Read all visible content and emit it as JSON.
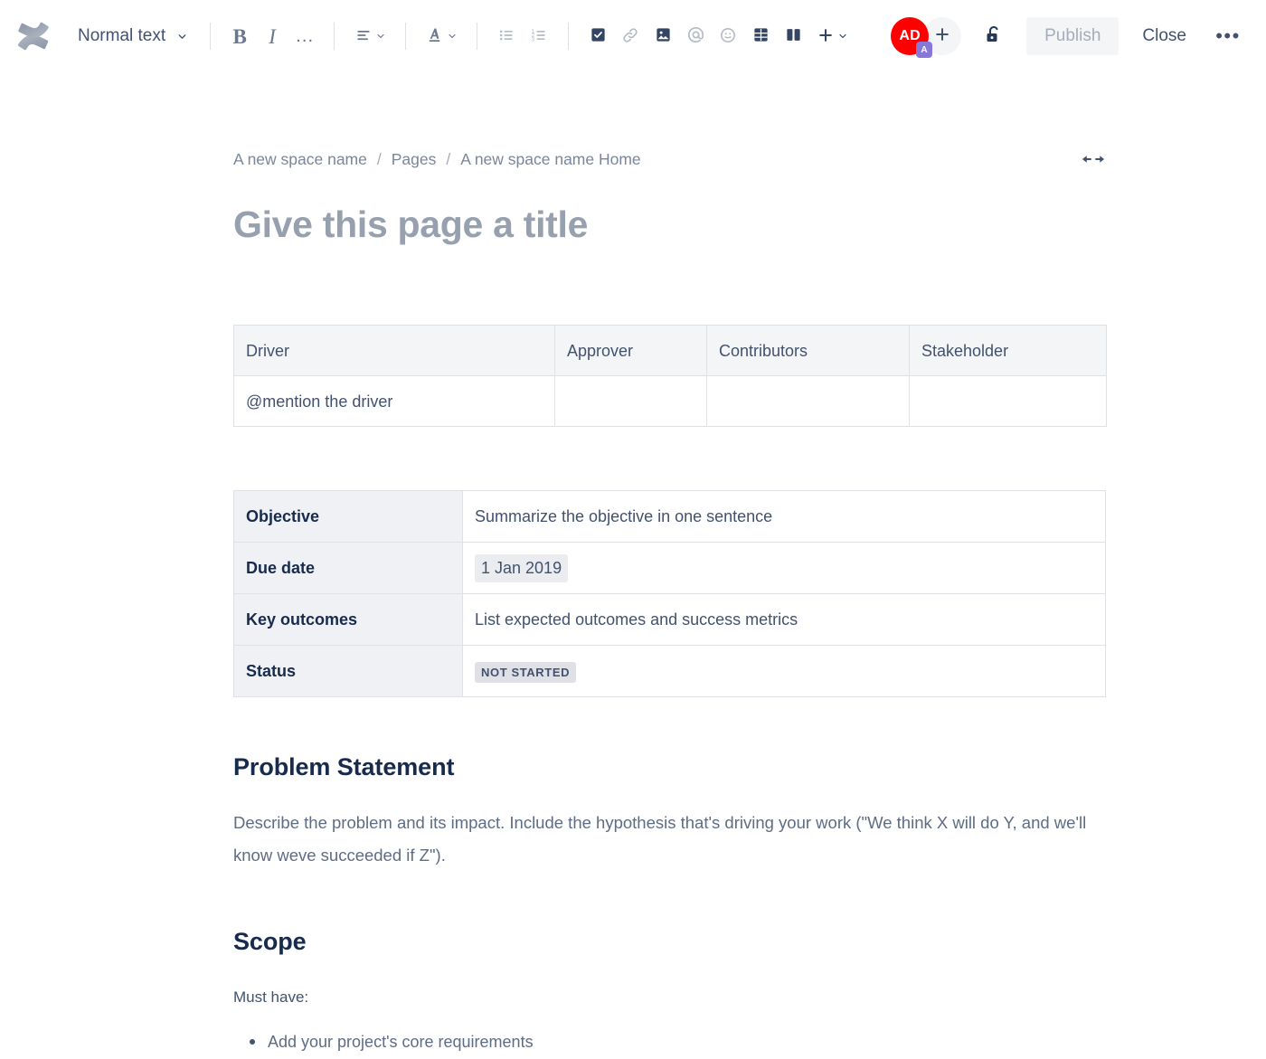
{
  "toolbar": {
    "logo_icon": "confluence-logo-icon",
    "text_style": {
      "label": "Normal text",
      "chevron_icon": "chevron-down-icon"
    },
    "bold_label": "B",
    "italic_label": "I",
    "more_formatting_label": "…",
    "align_icon": "text-align-left-icon",
    "text_color_icon": "text-color-icon",
    "bullet_list_icon": "bullet-list-icon",
    "numbered_list_icon": "numbered-list-icon",
    "task_list_icon": "task-checkbox-icon",
    "link_icon": "link-icon",
    "image_icon": "image-icon",
    "mention_icon": "mention-at-icon",
    "emoji_icon": "emoji-icon",
    "table_icon": "table-icon",
    "layout_icon": "page-layout-icon",
    "insert_icon": "plus-icon",
    "insert_chevron_icon": "chevron-down-icon",
    "avatar": {
      "initials": "AD",
      "badge": "A",
      "color": "#ff0000",
      "badge_color": "#8777d9"
    },
    "add_people_icon": "plus-icon",
    "restrictions_icon": "unlock-icon",
    "publish_label": "Publish",
    "close_label": "Close",
    "more_label": "•••"
  },
  "breadcrumb": {
    "items": [
      {
        "label": "A new space name"
      },
      {
        "label": "Pages"
      },
      {
        "label": "A new space name Home"
      }
    ],
    "separator": "/",
    "expand_icon": "expand-width-icon"
  },
  "page": {
    "title_placeholder": "Give this page a title"
  },
  "roles_table": {
    "headers": [
      "Driver",
      "Approver",
      "Contributors",
      "Stakeholder"
    ],
    "rows": [
      [
        "@mention the driver",
        "",
        "",
        ""
      ]
    ]
  },
  "details_table": {
    "rows": [
      {
        "label": "Objective",
        "value": "Summarize the objective in one sentence",
        "type": "text"
      },
      {
        "label": "Due date",
        "value": "1 Jan 2019",
        "type": "date"
      },
      {
        "label": "Key outcomes",
        "value": "List expected outcomes and success metrics",
        "type": "text"
      },
      {
        "label": "Status",
        "value": "NOT STARTED",
        "type": "lozenge"
      }
    ]
  },
  "sections": {
    "problem": {
      "heading": "Problem Statement",
      "body": "Describe the problem and its impact. Include the hypothesis that's driving your work (\"We think X will do Y, and we'll know weve succeeded if Z\")."
    },
    "scope": {
      "heading": "Scope",
      "lead": "Must have:",
      "bullets": [
        "Add your project's core requirements"
      ]
    }
  },
  "colors": {
    "accent": "#0052cc",
    "text_primary": "#172b4d",
    "text_secondary": "#5e6c84",
    "text_muted": "#7a869a",
    "border": "#dfe1e6",
    "surface_grey": "#f4f5f7"
  }
}
